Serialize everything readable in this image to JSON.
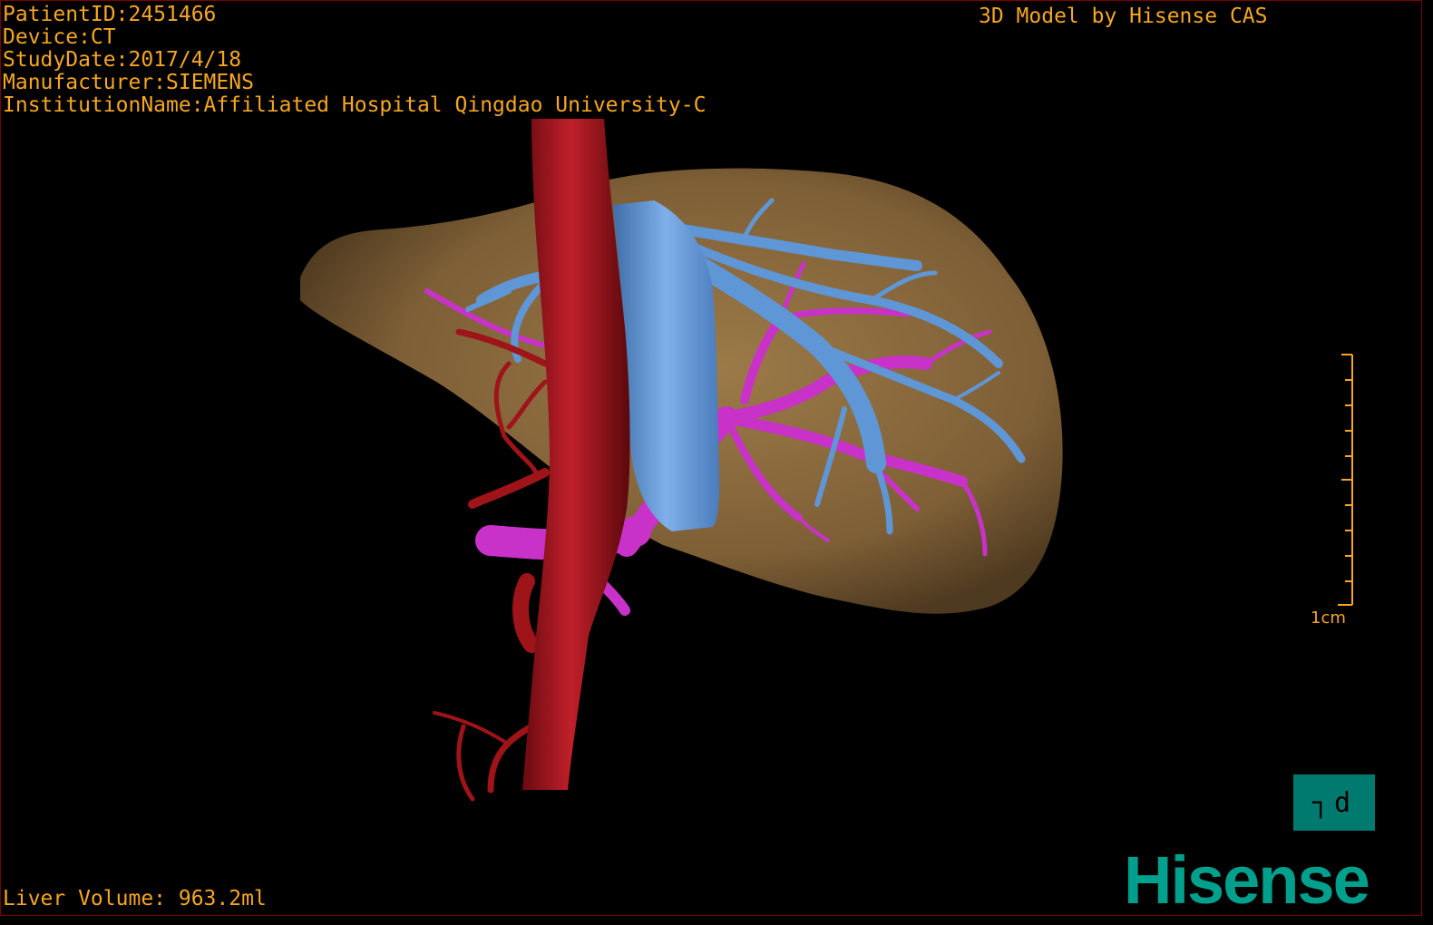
{
  "overlay": {
    "patient_id": "PatientID:2451466",
    "device": "Device:CT",
    "study_date": "StudyDate:2017/4/18",
    "manufacturer": "Manufacturer:SIEMENS",
    "institution": "InstitutionName:Affiliated Hospital Qingdao University-C",
    "model_credit": "3D Model by Hisense CAS",
    "liver_volume": "Liver Volume: 963.2ml"
  },
  "scale_bar": {
    "label": "1cm"
  },
  "view_toggle": {
    "label": "┐d"
  },
  "brand": {
    "logo_text": "Hisense"
  },
  "colors": {
    "overlay_text": "#f5a623",
    "liver": "#8a6a3c",
    "aorta": "#a3141c",
    "vena_cava": "#5e94d4",
    "portal_vein": "#c832c8",
    "brand": "#00a08d"
  }
}
